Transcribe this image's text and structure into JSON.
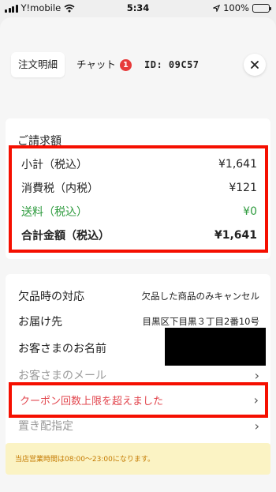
{
  "statusbar": {
    "carrier": "Y!mobile",
    "time": "5:34",
    "battery": "100%",
    "battery_fill": 1.0,
    "battery_color": "#3cc24a"
  },
  "tabs": {
    "order_details": "注文明細",
    "chat": "チャット",
    "chat_badge": "1",
    "order_id": "ID: 09C57",
    "close_icon": "close-icon"
  },
  "billing": {
    "title": "ご請求額",
    "rows": [
      {
        "label": "小計（税込）",
        "value": "¥1,641"
      },
      {
        "label": "消費税（内税）",
        "value": "¥121"
      },
      {
        "label": "送料（税込）",
        "value": "¥0"
      },
      {
        "label": "合計金額（税込）",
        "value": "¥1,641"
      }
    ]
  },
  "details": {
    "rows": [
      {
        "label": "欠品時の対応",
        "value": "欠品した商品のみキャンセル"
      },
      {
        "label": "お届け先",
        "value": "目黒区下目黒３丁目2番10号"
      },
      {
        "label": "お客さまのお名前",
        "value": ""
      },
      {
        "label": "お客さまのメール"
      },
      {
        "label": "クーポン回数上限を超えました"
      },
      {
        "label": "置き配指定"
      }
    ]
  },
  "notice": {
    "text": "当店営業時間は08:00〜23:00になります。"
  },
  "colors": {
    "highlight_border": "#f50f00",
    "badge": "#e73a3a",
    "shipping_green": "#2e9b3e",
    "coupon_text": "#e2474f",
    "notice_bg": "#fbf3c4"
  }
}
